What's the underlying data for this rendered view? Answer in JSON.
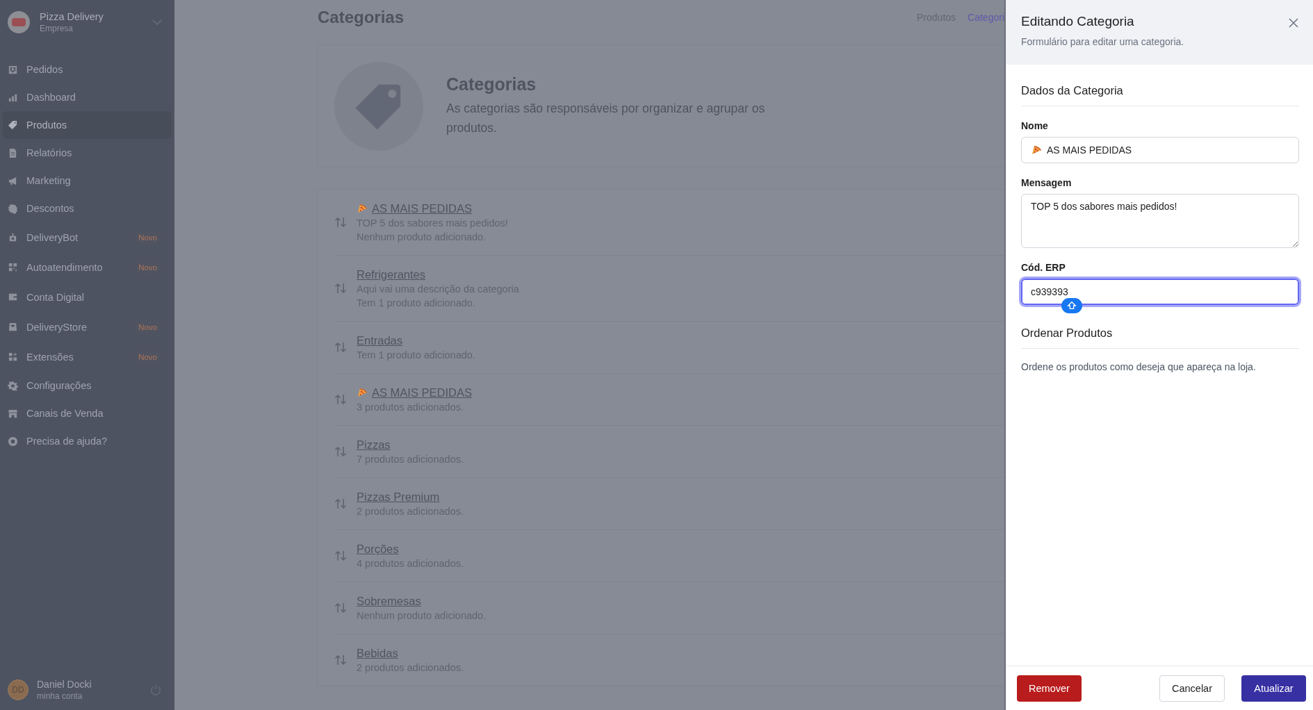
{
  "sidebar": {
    "company": {
      "name": "Pizza Delivery",
      "subtitle": "Empresa"
    },
    "items": [
      {
        "label": "Pedidos",
        "selected": false
      },
      {
        "label": "Dashboard",
        "selected": false
      },
      {
        "label": "Produtos",
        "selected": true
      },
      {
        "label": "Relatórios",
        "selected": false
      },
      {
        "label": "Marketing",
        "selected": false
      },
      {
        "label": "Descontos",
        "selected": false
      },
      {
        "label": "DeliveryBot",
        "selected": false,
        "badge": "Novo"
      },
      {
        "label": "Autoatendimento",
        "selected": false,
        "badge": "Novo"
      },
      {
        "label": "Conta Digital",
        "selected": false
      },
      {
        "label": "DeliveryStore",
        "selected": false,
        "badge": "Novo"
      },
      {
        "label": "Extensões",
        "selected": false,
        "badge": "Novo"
      },
      {
        "label": "Configurações",
        "selected": false
      },
      {
        "label": "Canais de Venda",
        "selected": false
      },
      {
        "label": "Precisa de ajuda?",
        "selected": false
      }
    ],
    "user": {
      "initials": "DD",
      "name": "Daniel Docki",
      "subtitle": "minha conta"
    }
  },
  "page": {
    "title": "Categorias",
    "breadcrumbs": [
      {
        "label": "Produtos",
        "selected": false
      },
      {
        "label": "Categori",
        "selected": true
      }
    ]
  },
  "hero": {
    "title": "Categorias",
    "description": "As categorias são responsáveis por organizar e agrupar os produtos."
  },
  "categories": [
    {
      "name": "AS MAIS PEDIDAS",
      "pizza_icon": true,
      "description": "TOP 5 dos sabores mais pedidos!",
      "count": "Nenhum produto adicionado."
    },
    {
      "name": "Refrigerantes",
      "pizza_icon": false,
      "description": "Aqui vai uma descrição da categoria",
      "count": "Tem 1 produto adicionado."
    },
    {
      "name": "Entradas",
      "pizza_icon": false,
      "count": "Tem 1 produto adicionado."
    },
    {
      "name": "AS MAIS PEDIDAS",
      "pizza_icon": true,
      "count": "3 produtos adicionados."
    },
    {
      "name": "Pizzas",
      "pizza_icon": false,
      "count": "7 produtos adicionados."
    },
    {
      "name": "Pizzas Premium",
      "pizza_icon": false,
      "count": "2 produtos adicionados."
    },
    {
      "name": "Porções",
      "pizza_icon": false,
      "count": "4 produtos adicionados."
    },
    {
      "name": "Sobremesas",
      "pizza_icon": false,
      "count": "Nenhum produto adicionado."
    },
    {
      "name": "Bebidas",
      "pizza_icon": false,
      "count": "2 produtos adicionados."
    }
  ],
  "panel": {
    "title": "Editando Categoria",
    "subtitle": "Formulário para editar uma categoria.",
    "section_title": "Dados da Categoria",
    "fields": [
      {
        "kind": "text",
        "label": "Nome",
        "value": "AS MAIS PEDIDAS",
        "pizza_icon": true,
        "focused": false
      },
      {
        "kind": "textarea",
        "label": "Mensagem",
        "value": "TOP 5 dos sabores mais pedidos!",
        "focused": false
      },
      {
        "kind": "text",
        "label": "Cód. ERP",
        "value": "c939393",
        "pizza_icon": false,
        "focused": true
      }
    ],
    "order_title": "Ordenar Produtos",
    "order_text": "Ordene os produtos como deseja que apareça na loja.",
    "buttons": [
      {
        "kind": "danger",
        "label": "Remover"
      },
      {
        "kind": "secondary",
        "label": "Cancelar"
      },
      {
        "kind": "primary",
        "label": "Atualizar"
      }
    ]
  }
}
